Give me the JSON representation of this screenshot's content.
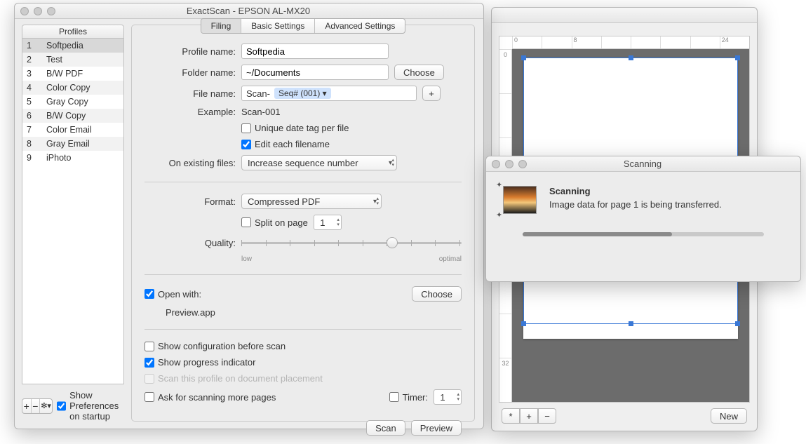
{
  "main_window": {
    "title": "ExactScan - EPSON AL-MX20",
    "profiles_header": "Profiles",
    "profiles": [
      {
        "n": "1",
        "name": "Softpedia",
        "selected": true
      },
      {
        "n": "2",
        "name": "Test"
      },
      {
        "n": "3",
        "name": "B/W PDF"
      },
      {
        "n": "4",
        "name": "Color Copy"
      },
      {
        "n": "5",
        "name": "Gray Copy"
      },
      {
        "n": "6",
        "name": "B/W Copy"
      },
      {
        "n": "7",
        "name": "Color Email"
      },
      {
        "n": "8",
        "name": "Gray Email"
      },
      {
        "n": "9",
        "name": "iPhoto"
      }
    ],
    "show_prefs_label": "Show Preferences on startup",
    "tabs": {
      "filing": "Filing",
      "basic": "Basic Settings",
      "advanced": "Advanced Settings"
    },
    "labels": {
      "profile_name": "Profile name:",
      "folder_name": "Folder name:",
      "file_name": "File name:",
      "example": "Example:",
      "on_existing": "On existing files:",
      "format": "Format:",
      "quality": "Quality:",
      "open_with": "Open with:",
      "timer": "Timer:"
    },
    "values": {
      "profile_name": "Softpedia",
      "folder_name": "~/Documents",
      "file_prefix": "Scan-",
      "file_token": "Seq# (001) ▾",
      "example": "Scan-001",
      "on_existing": "Increase sequence number",
      "format": "Compressed PDF",
      "split_page": "1",
      "open_with_app": "Preview.app",
      "timer": "1"
    },
    "checkboxes": {
      "unique_date": "Unique date tag per file",
      "edit_each": "Edit each filename",
      "split_on_page": "Split on page",
      "show_config": "Show configuration before scan",
      "show_progress": "Show progress indicator",
      "scan_profile_placement": "Scan this profile on document placement",
      "ask_more": "Ask for scanning more pages"
    },
    "slider": {
      "low": "low",
      "optimal": "optimal"
    },
    "buttons": {
      "choose": "Choose",
      "plus": "+",
      "scan": "Scan",
      "preview": "Preview",
      "add": "+",
      "remove": "−",
      "gear": "✻▾"
    }
  },
  "preview_window": {
    "ruler_h": [
      "0",
      "",
      "8",
      "",
      "",
      "",
      "",
      "24"
    ],
    "ruler_v": [
      "0",
      "",
      "",
      "",
      "",
      "",
      "",
      "32"
    ],
    "buttons": {
      "fit": "*",
      "zoom_in": "+",
      "zoom_out": "−",
      "new": "New"
    }
  },
  "scan_dialog": {
    "title": "Scanning",
    "heading": "Scanning",
    "message": "Image data for page 1 is being transferred."
  }
}
